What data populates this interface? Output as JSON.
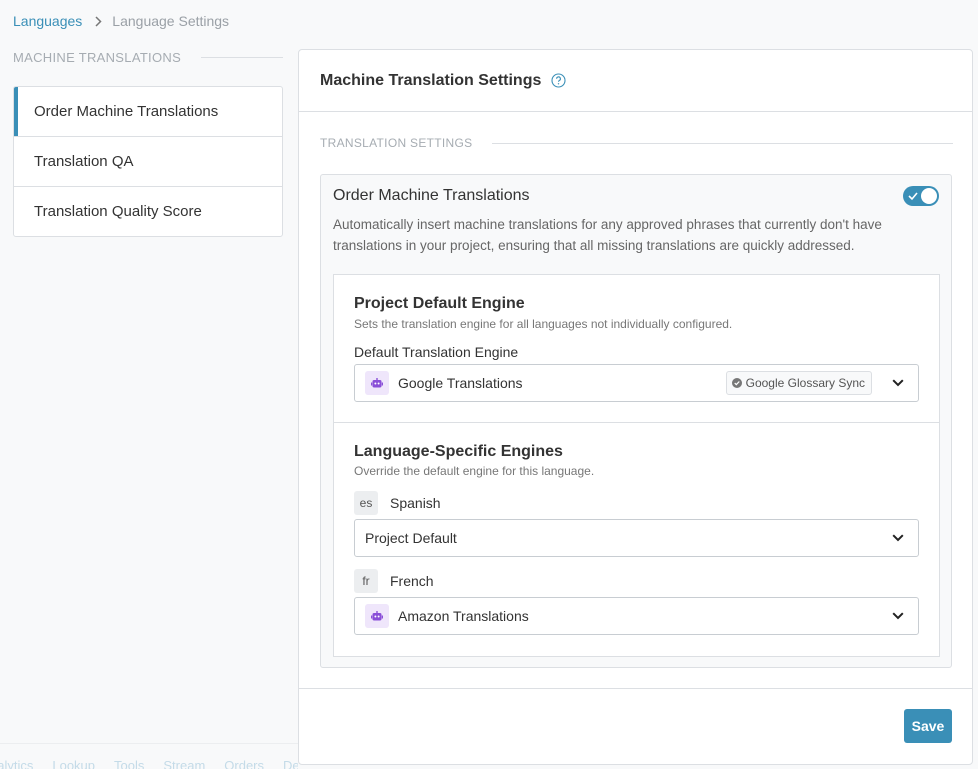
{
  "breadcrumb": {
    "parent": "Languages",
    "current": "Language Settings"
  },
  "sidebar": {
    "section_title": "MACHINE TRANSLATIONS",
    "items": [
      {
        "label": "Order Machine Translations",
        "active": true
      },
      {
        "label": "Translation QA",
        "active": false
      },
      {
        "label": "Translation Quality Score",
        "active": false
      }
    ]
  },
  "panel": {
    "title": "Machine Translation Settings",
    "section_title": "TRANSLATION SETTINGS",
    "card": {
      "title": "Order Machine Translations",
      "enabled": true,
      "description": "Automatically insert machine translations for any approved phrases that currently don't have translations in your project, ensuring that all missing translations are quickly addressed."
    },
    "default_engine": {
      "title": "Project Default Engine",
      "subtitle": "Sets the translation engine for all languages not individually configured.",
      "field_label": "Default Translation Engine",
      "selected": "Google Translations",
      "badge": "Google Glossary Sync"
    },
    "language_engines": {
      "title": "Language-Specific Engines",
      "subtitle": "Override the default engine for this language.",
      "languages": [
        {
          "code": "es",
          "name": "Spanish",
          "selected": "Project Default"
        },
        {
          "code": "fr",
          "name": "French",
          "selected": "Amazon Translations"
        }
      ]
    },
    "save_label": "Save"
  },
  "bottom_nav": {
    "tabs": [
      "nalytics",
      "Lookup",
      "Tools",
      "Stream",
      "Orders",
      "Design"
    ],
    "collapse_glyph": "«"
  },
  "colors": {
    "accent": "#3a8fb7",
    "engine_icon_bg": "#efe6fb",
    "engine_icon": "#8a4fd8"
  }
}
